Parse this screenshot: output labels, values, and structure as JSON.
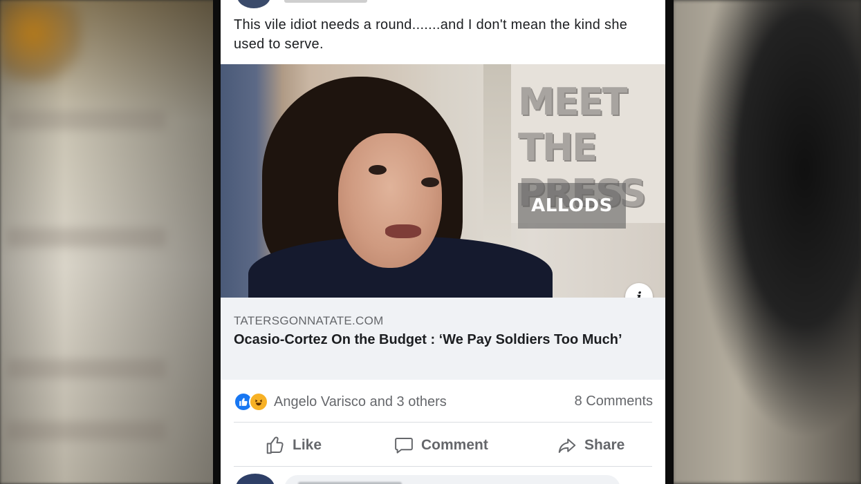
{
  "post": {
    "text": "This vile idiot needs a round.......and I don't mean the kind she used to serve."
  },
  "image": {
    "backdrop_text": "MEET THE PRESS",
    "watermark_text": "ALLODS"
  },
  "link_preview": {
    "domain": "TATERSGONNATATE.COM",
    "title": "Ocasio-Cortez On the Budget : ‘We Pay Soldiers Too Much’",
    "info_icon": "i"
  },
  "engagement": {
    "reactions_text": "Angelo Varisco and 3 others",
    "comments_count": "8 Comments",
    "reaction_icons": [
      "like-icon",
      "haha-icon"
    ]
  },
  "actions": {
    "like_label": "Like",
    "comment_label": "Comment",
    "share_label": "Share"
  },
  "colors": {
    "like_blue": "#1877f2",
    "haha_yellow": "#f7b125",
    "secondary_text": "#65676b",
    "primary_text": "#1c1e21",
    "link_preview_bg": "#f0f2f5"
  }
}
